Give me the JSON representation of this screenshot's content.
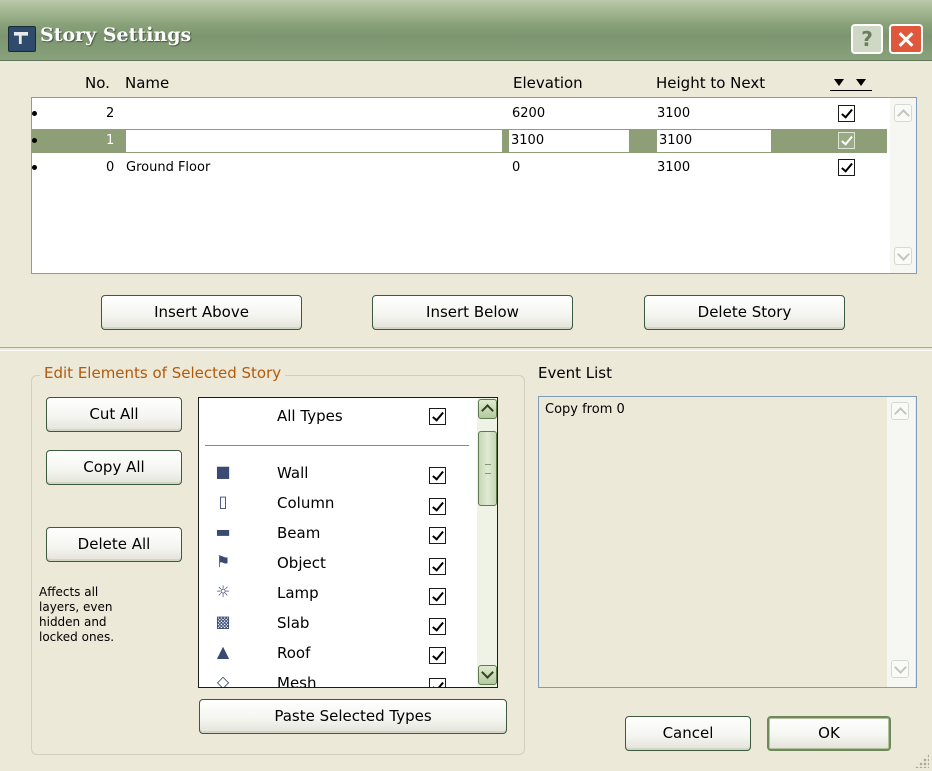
{
  "window": {
    "title": "Story Settings"
  },
  "title_buttons": {
    "help": "?",
    "close_icon": "close-icon"
  },
  "stories_header": {
    "no": "No.",
    "name": "Name",
    "elevation": "Elevation",
    "height": "Height to Next"
  },
  "stories": [
    {
      "no": "2",
      "name": "",
      "elevation": "6200",
      "height": "3100",
      "checked": true,
      "selected": false
    },
    {
      "no": "1",
      "name": "",
      "elevation": "3100",
      "height": "3100",
      "checked": true,
      "selected": true
    },
    {
      "no": "0",
      "name": "Ground Floor",
      "elevation": "0",
      "height": "3100",
      "checked": true,
      "selected": false
    }
  ],
  "story_buttons": {
    "insert_above": "Insert Above",
    "insert_below": "Insert Below",
    "delete_story": "Delete Story"
  },
  "edit_group": {
    "title": "Edit Elements of Selected Story",
    "cut_all": "Cut All",
    "copy_all": "Copy All",
    "delete_all": "Delete All",
    "affects_note": "Affects all layers, even hidden and locked ones.",
    "paste_selected": "Paste Selected Types"
  },
  "types": {
    "all_label": "All Types",
    "items": [
      {
        "label": "Wall",
        "icon": "wall-icon",
        "checked": true
      },
      {
        "label": "Column",
        "icon": "column-icon",
        "checked": true
      },
      {
        "label": "Beam",
        "icon": "beam-icon",
        "checked": true
      },
      {
        "label": "Object",
        "icon": "object-icon",
        "checked": true
      },
      {
        "label": "Lamp",
        "icon": "lamp-icon",
        "checked": true
      },
      {
        "label": "Slab",
        "icon": "slab-icon",
        "checked": true
      },
      {
        "label": "Roof",
        "icon": "roof-icon",
        "checked": true
      },
      {
        "label": "Mesh",
        "icon": "mesh-icon",
        "checked": true
      }
    ]
  },
  "event_list": {
    "label": "Event List",
    "entries": [
      "Copy from 0"
    ]
  },
  "dialog_buttons": {
    "cancel": "Cancel",
    "ok": "OK"
  },
  "colors": {
    "title_bar": "#8aa27a",
    "selection": "#8e9e76",
    "group_title": "#b25a0c",
    "close": "#e0583c"
  }
}
